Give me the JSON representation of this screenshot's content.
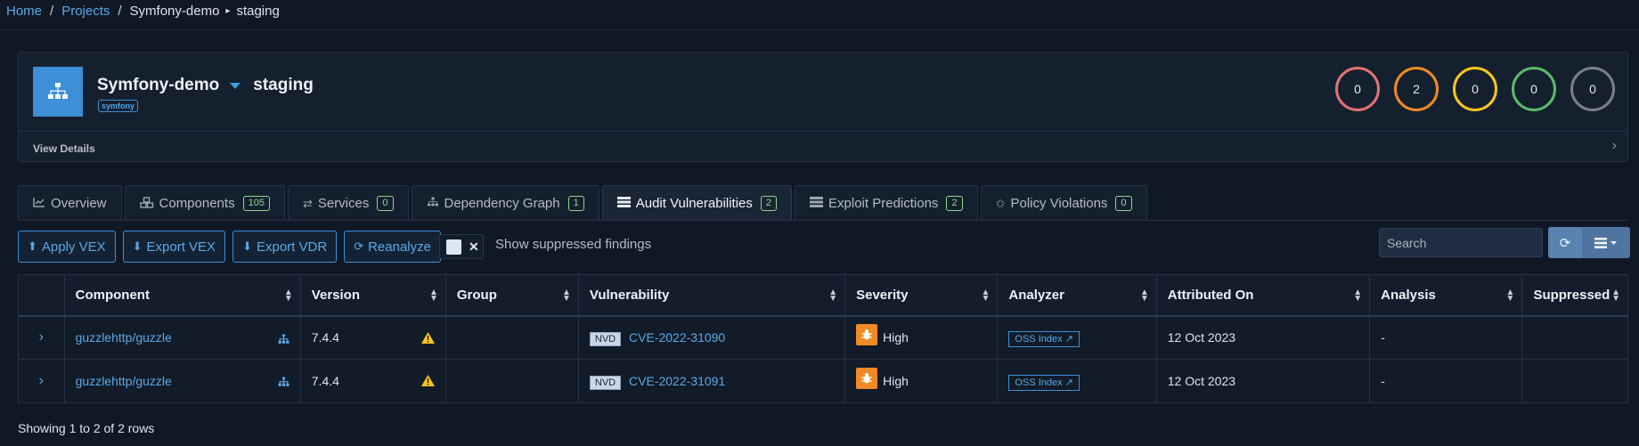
{
  "breadcrumb": {
    "home": "Home",
    "projects": "Projects",
    "project": "Symfony-demo",
    "version": "staging"
  },
  "project": {
    "name": "Symfony-demo",
    "version": "staging",
    "tag": "symfony",
    "view_details": "View Details",
    "counts": {
      "critical": "0",
      "high": "2",
      "medium": "0",
      "low": "0",
      "unassigned": "0"
    }
  },
  "tabs": [
    {
      "label": "Overview",
      "icon": "chart-line-icon"
    },
    {
      "label": "Components",
      "badge": "105",
      "icon": "cubes-icon"
    },
    {
      "label": "Services",
      "badge": "0",
      "icon": "exchange-icon"
    },
    {
      "label": "Dependency Graph",
      "badge": "1",
      "icon": "sitemap-icon"
    },
    {
      "label": "Audit Vulnerabilities",
      "badge": "2",
      "icon": "tasks-icon",
      "active": true
    },
    {
      "label": "Exploit Predictions",
      "badge": "2",
      "icon": "tasks-icon"
    },
    {
      "label": "Policy Violations",
      "badge": "0",
      "icon": "fire-icon"
    }
  ],
  "toolbar": {
    "apply_vex": "Apply VEX",
    "export_vex": "Export VEX",
    "export_vdr": "Export VDR",
    "reanalyze": "Reanalyze",
    "show_suppressed": "Show suppressed findings",
    "search_placeholder": "Search"
  },
  "table": {
    "headers": [
      "Component",
      "Version",
      "Group",
      "Vulnerability",
      "Severity",
      "Analyzer",
      "Attributed On",
      "Analysis",
      "Suppressed"
    ],
    "rows": [
      {
        "component": "guzzlehttp/guzzle",
        "version": "7.4.4",
        "group": "",
        "source": "NVD",
        "vulnerability": "CVE-2022-31090",
        "severity": "High",
        "analyzer": "OSS Index",
        "attributed_on": "12 Oct 2023",
        "analysis": "-",
        "suppressed": ""
      },
      {
        "component": "guzzlehttp/guzzle",
        "version": "7.4.4",
        "group": "",
        "source": "NVD",
        "vulnerability": "CVE-2022-31091",
        "severity": "High",
        "analyzer": "OSS Index",
        "attributed_on": "12 Oct 2023",
        "analysis": "-",
        "suppressed": ""
      }
    ]
  },
  "footer": "Showing 1 to 2 of 2 rows",
  "colors": {
    "accent": "#3d8fd6",
    "high": "#f08a24",
    "critical": "#e27373",
    "medium": "#f7c51d",
    "low": "#5cba6a",
    "unassigned": "#7a7f86"
  }
}
